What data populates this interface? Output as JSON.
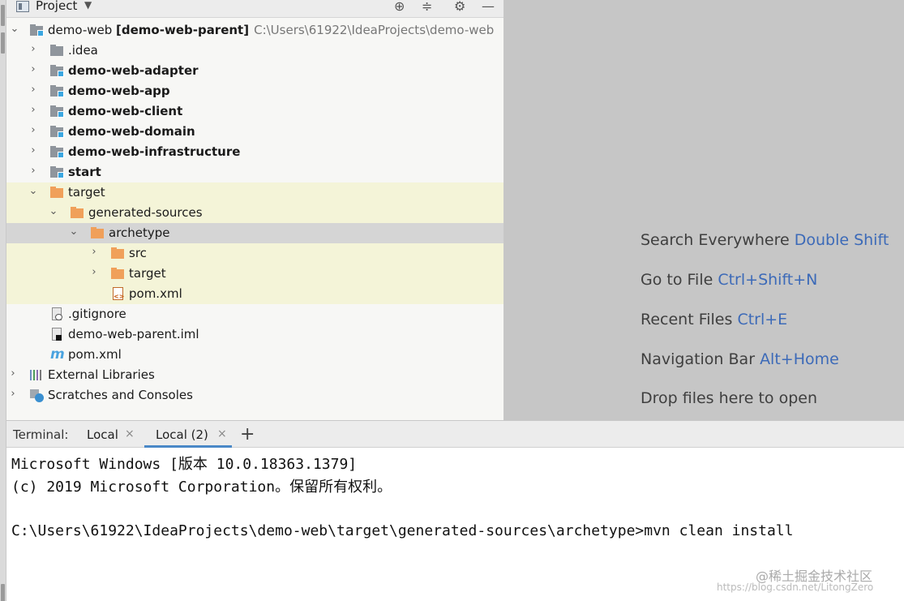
{
  "project": {
    "title": "Project",
    "tree": [
      {
        "label": "demo-web",
        "bracket": "[demo-web-parent]",
        "path": "C:\\Users\\61922\\IdeaProjects\\demo-web"
      },
      {
        "label": ".idea"
      },
      {
        "label": "demo-web-adapter"
      },
      {
        "label": "demo-web-app"
      },
      {
        "label": "demo-web-client"
      },
      {
        "label": "demo-web-domain"
      },
      {
        "label": "demo-web-infrastructure"
      },
      {
        "label": "start"
      },
      {
        "label": "target"
      },
      {
        "label": "generated-sources"
      },
      {
        "label": "archetype"
      },
      {
        "label": "src"
      },
      {
        "label": "target"
      },
      {
        "label": "pom.xml"
      },
      {
        "label": ".gitignore"
      },
      {
        "label": "demo-web-parent.iml"
      },
      {
        "label": "pom.xml"
      },
      {
        "label": "External Libraries"
      },
      {
        "label": "Scratches and Consoles"
      }
    ]
  },
  "editor_hints": [
    {
      "text": "Search Everywhere",
      "key": "Double Shift"
    },
    {
      "text": "Go to File",
      "key": "Ctrl+Shift+N"
    },
    {
      "text": "Recent Files",
      "key": "Ctrl+E"
    },
    {
      "text": "Navigation Bar",
      "key": "Alt+Home"
    },
    {
      "text": "Drop files here to open",
      "key": ""
    }
  ],
  "terminal": {
    "label": "Terminal:",
    "tabs": [
      {
        "label": "Local",
        "close": "×"
      },
      {
        "label": "Local (2)",
        "close": "×"
      }
    ],
    "add": "+",
    "lines": [
      "Microsoft Windows [版本 10.0.18363.1379]",
      "(c) 2019 Microsoft Corporation。保留所有权利。",
      "",
      "C:\\Users\\61922\\IdeaProjects\\demo-web\\target\\generated-sources\\archetype>mvn clean install"
    ]
  },
  "watermark": {
    "line1": "@稀土掘金技术社区",
    "line2": "https://blog.csdn.net/LitongZero"
  }
}
